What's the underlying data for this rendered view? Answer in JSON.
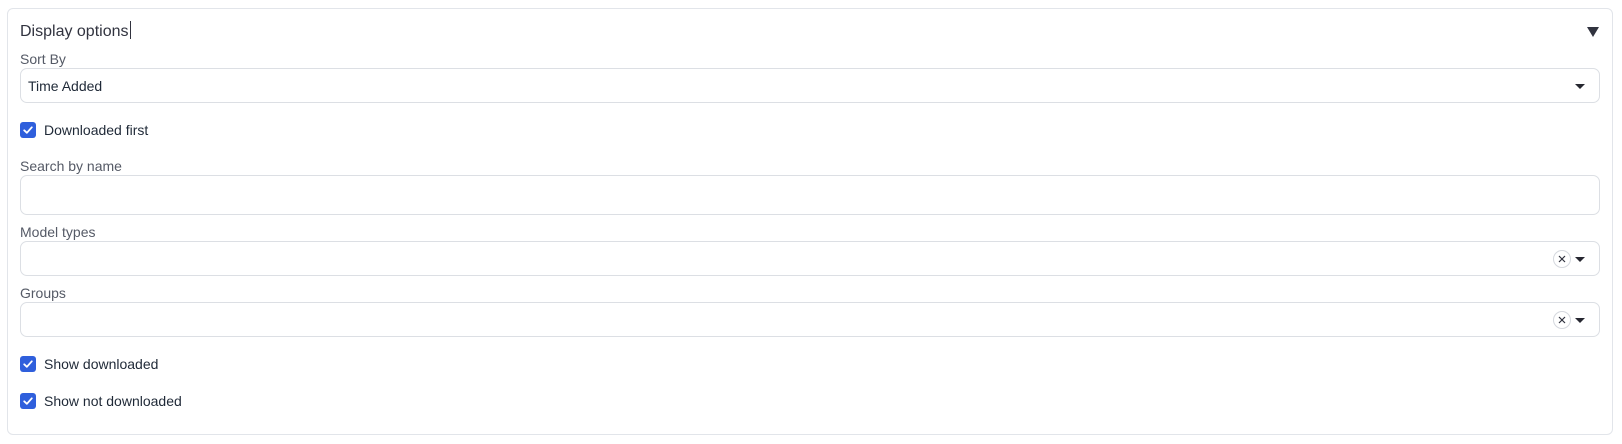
{
  "panel": {
    "title": "Display options",
    "expanded": true
  },
  "sort_by": {
    "label": "Sort By",
    "value": "Time Added"
  },
  "downloaded_first": {
    "label": "Downloaded first",
    "checked": true
  },
  "search": {
    "label": "Search by name",
    "value": "",
    "placeholder": ""
  },
  "model_types": {
    "label": "Model types",
    "value": ""
  },
  "groups": {
    "label": "Groups",
    "value": ""
  },
  "show_downloaded": {
    "label": "Show downloaded",
    "checked": true
  },
  "show_not_downloaded": {
    "label": "Show not downloaded",
    "checked": true
  },
  "colors": {
    "checkbox": "#2f5fdc",
    "border": "#dcdfe4",
    "text": "#1f2937",
    "label": "#555a66"
  },
  "icons": {
    "collapse": "triangle-down-icon",
    "caret": "caret-down-icon",
    "clear": "close-circle-icon",
    "check": "check-icon"
  }
}
